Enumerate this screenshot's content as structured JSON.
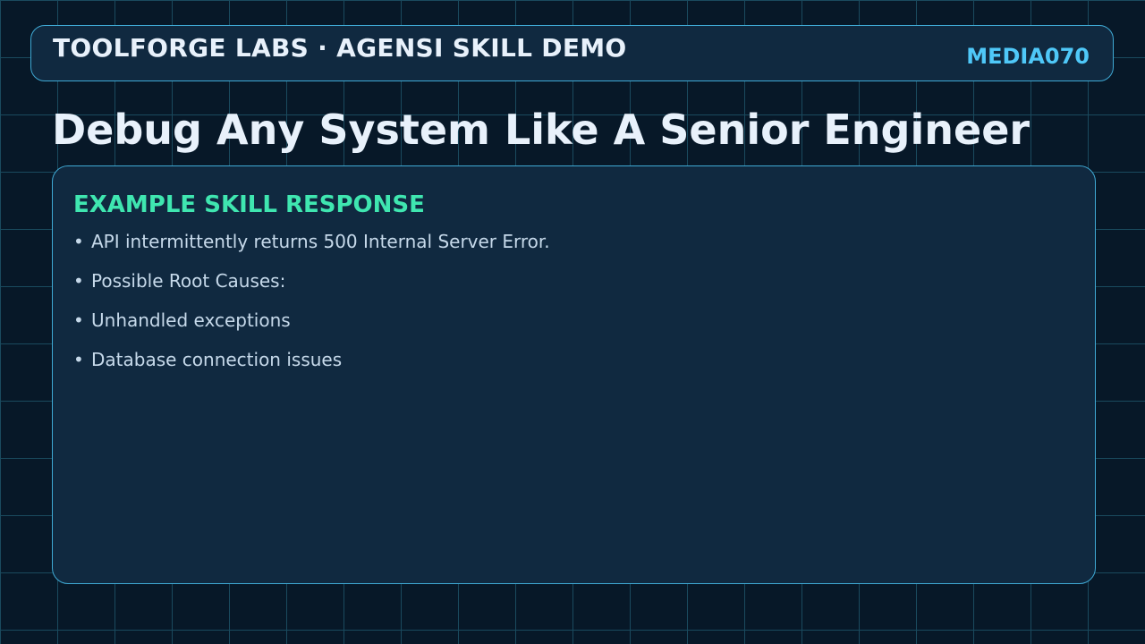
{
  "header": {
    "brand": "TOOLFORGE LABS · AGENSI SKILL DEMO",
    "media_id": "MEDIA070"
  },
  "page": {
    "title": "Debug Any System Like A Senior Engineer"
  },
  "card": {
    "heading": "EXAMPLE SKILL RESPONSE",
    "bullet_glyph": "•",
    "items": [
      "API intermittently returns 500 Internal Server Error.",
      "Possible Root Causes:",
      "Unhandled exceptions",
      "Database connection issues"
    ]
  },
  "colors": {
    "background": "#071828",
    "grid_line": "#1a4a5e",
    "panel": "#102940",
    "panel_border": "#3fa9d4",
    "title_text": "#e8f1fb",
    "accent_cyan": "#4fc8f8",
    "accent_green": "#3fe6b0",
    "body_text": "#c6d9ea"
  }
}
